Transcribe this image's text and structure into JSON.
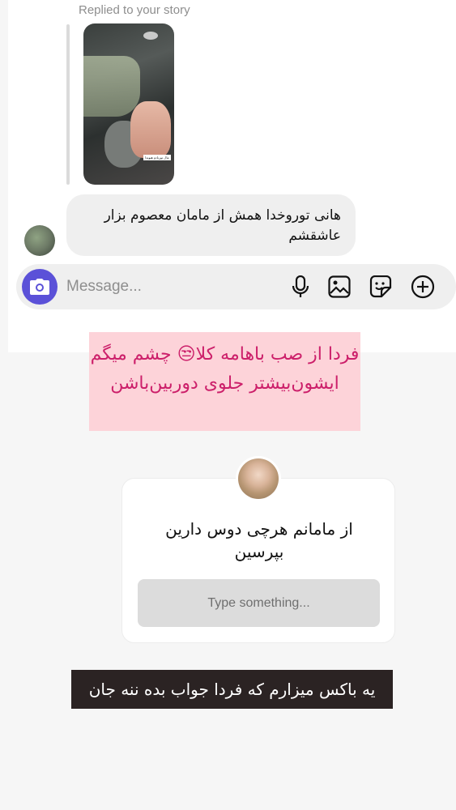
{
  "thread": {
    "replied_label": "Replied to your story",
    "story_caption": "مال تورنادو هیوندا",
    "message_text": "هانی توروخدا همش از مامان معصوم بزار عاشقشم"
  },
  "composer": {
    "placeholder": "Message...",
    "icons": [
      "camera-icon",
      "microphone-icon",
      "gallery-icon",
      "sticker-icon",
      "add-icon"
    ],
    "accent": "#5b51d8"
  },
  "story_overlay": {
    "caption_top": "فردا از صب باهامه کلا😒 چشم میگم ایشون‌بیشتر جلوی دوربین‌باشن",
    "question_text": "از مامانم هرچی دوس دارین بپرسین",
    "answer_placeholder": "Type something...",
    "caption_bottom": "یه باکس میزارم که فردا جواب بده ننه جان",
    "pink_bg": "#fdd3d9",
    "pink_text": "#cc1f6a",
    "dark_bg": "#2b2323"
  }
}
